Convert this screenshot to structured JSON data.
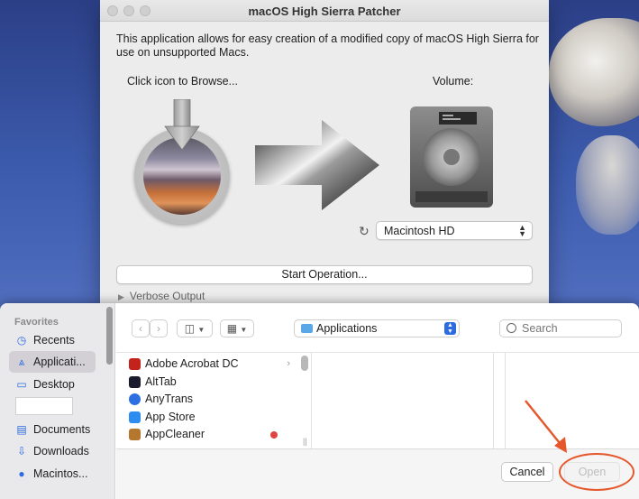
{
  "patcher": {
    "title": "macOS High Sierra Patcher",
    "description": "This application allows for easy creation of a modified copy of macOS High Sierra for use on unsupported Macs.",
    "browse_label": "Click icon to Browse...",
    "volume_label": "Volume:",
    "volume_selected": "Macintosh HD",
    "start_button": "Start Operation...",
    "verbose_label": "Verbose Output"
  },
  "open_dialog": {
    "sidebar": {
      "header": "Favorites",
      "items": [
        {
          "label": "Recents",
          "icon": "clock-icon",
          "selected": false
        },
        {
          "label": "Applicati...",
          "icon": "applications-icon",
          "selected": true
        },
        {
          "label": "Desktop",
          "icon": "desktop-icon",
          "selected": false
        },
        {
          "label": "Documents",
          "icon": "documents-icon",
          "selected": false
        },
        {
          "label": "Downloads",
          "icon": "downloads-icon",
          "selected": false
        },
        {
          "label": "Macintos...",
          "icon": "disk-icon",
          "selected": false
        }
      ]
    },
    "location": "Applications",
    "search_placeholder": "Search",
    "files": [
      {
        "name": "Adobe Acrobat DC",
        "icon_color": "#c4231c",
        "has_submenu": true,
        "tag": false
      },
      {
        "name": "AltTab",
        "icon_color": "#1a1a2e",
        "has_submenu": false,
        "tag": false
      },
      {
        "name": "AnyTrans",
        "icon_color": "#2d6fe0",
        "has_submenu": false,
        "tag": false
      },
      {
        "name": "App Store",
        "icon_color": "#2d8cf0",
        "has_submenu": false,
        "tag": false
      },
      {
        "name": "AppCleaner",
        "icon_color": "#b5762e",
        "has_submenu": false,
        "tag": true
      }
    ],
    "cancel_button": "Cancel",
    "open_button": "Open"
  },
  "colors": {
    "accent": "#2c6ce0",
    "annotation": "#e4582c",
    "tag_red": "#e0443e"
  }
}
